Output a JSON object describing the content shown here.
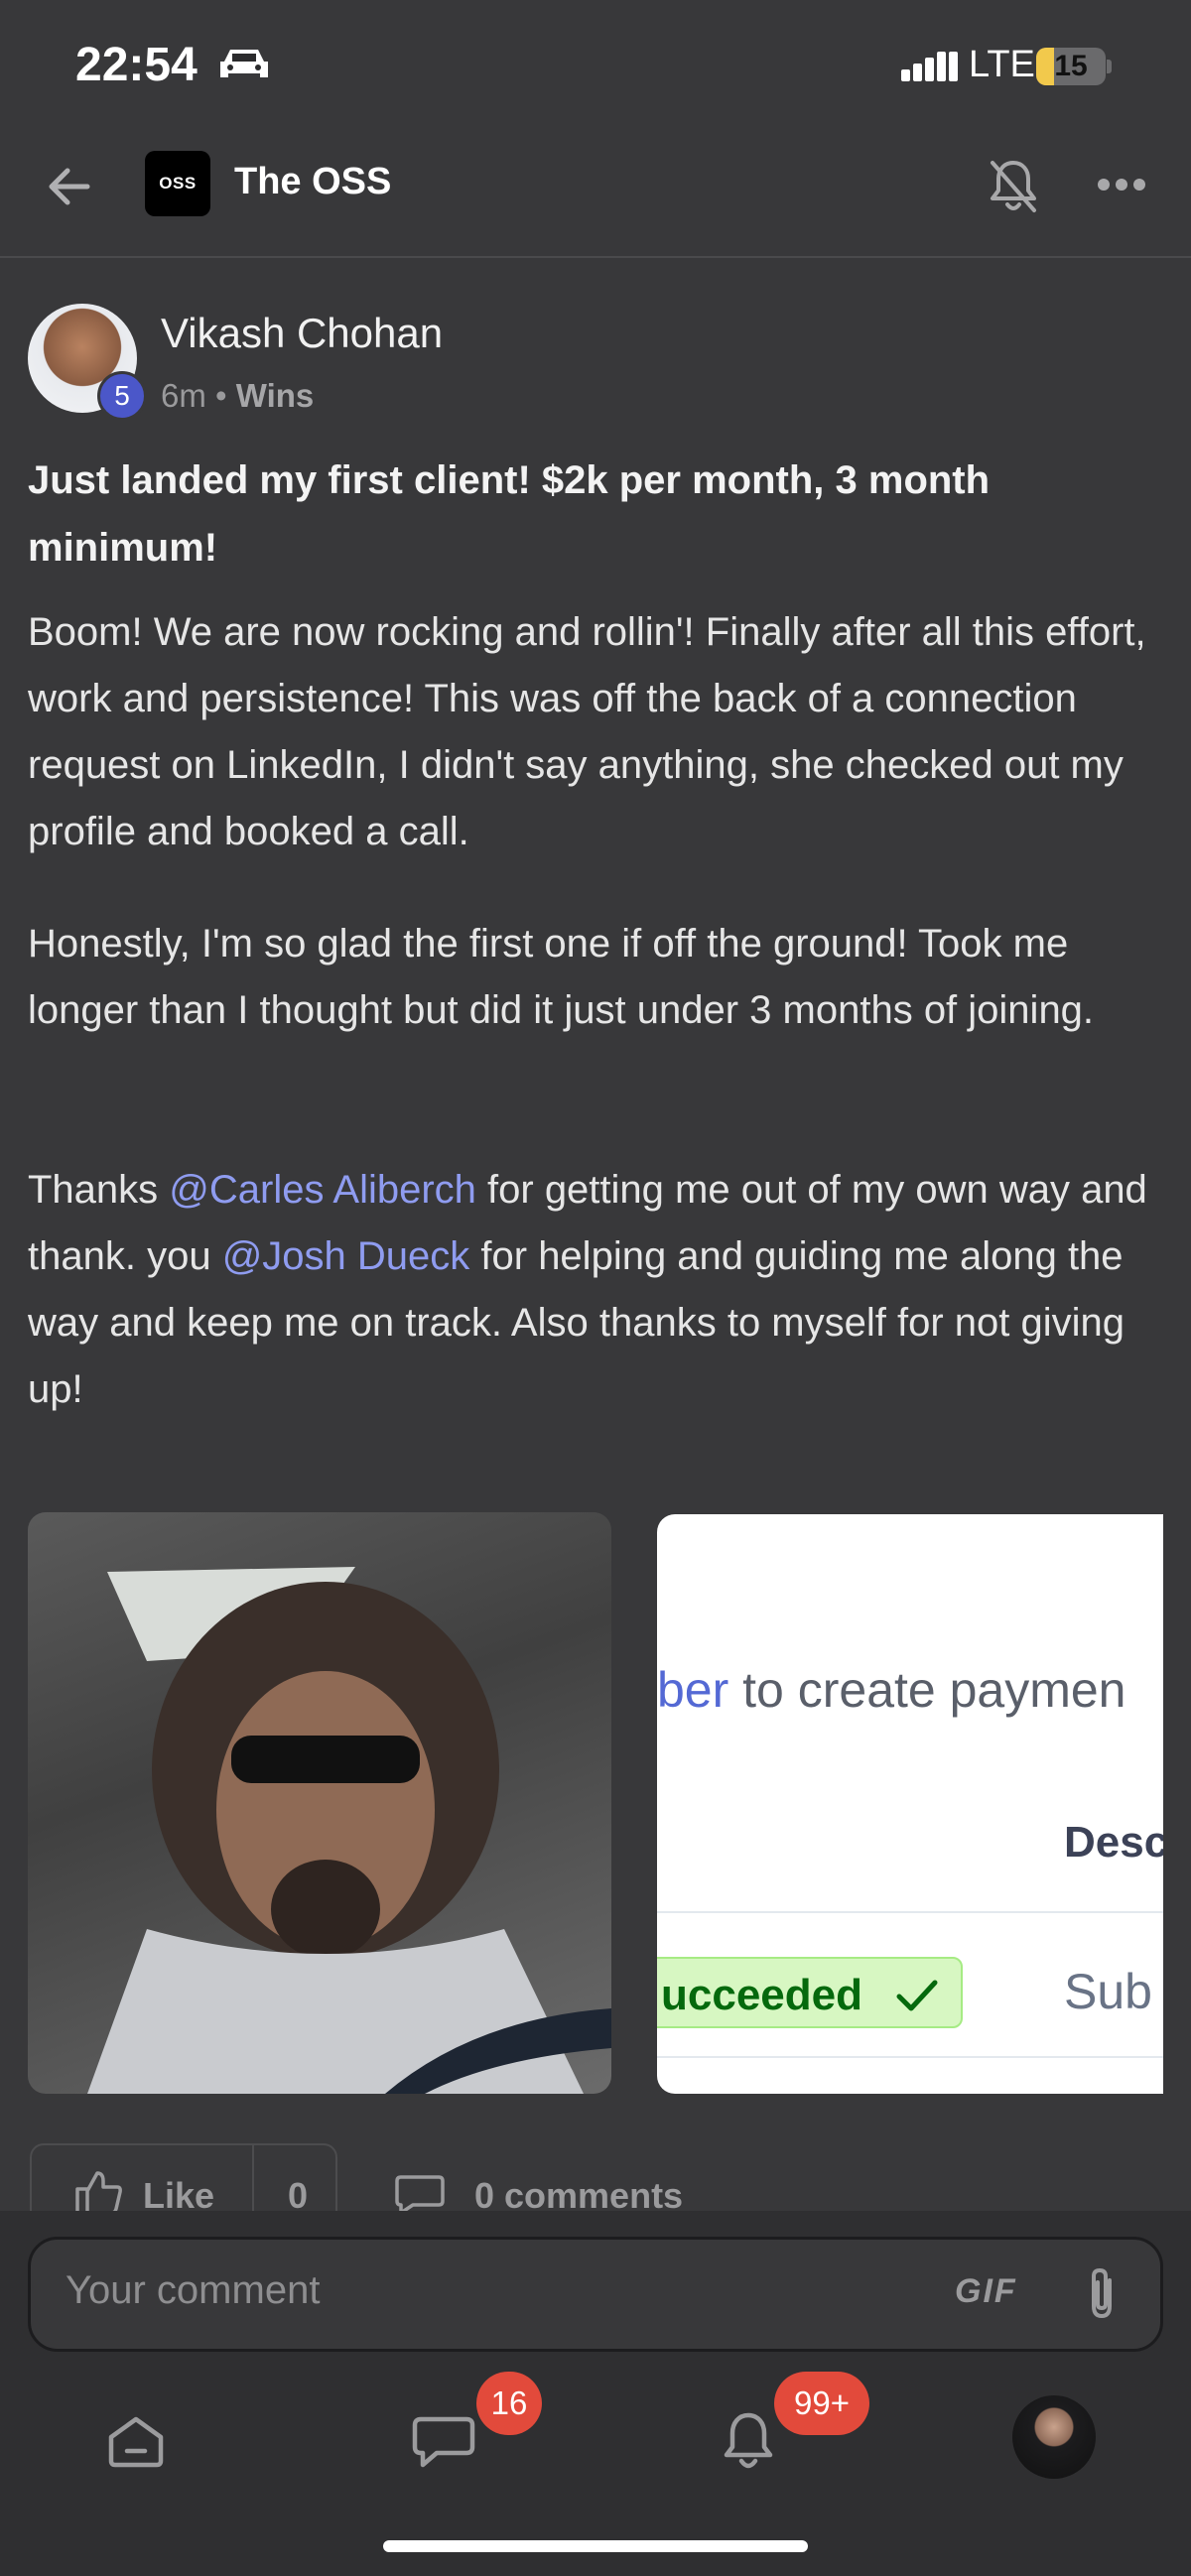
{
  "status_bar": {
    "time": "22:54",
    "network": "LTE",
    "battery": "15"
  },
  "header": {
    "group_logo": "OSS",
    "group_name": "The OSS"
  },
  "post": {
    "author": "Vikash Chohan",
    "level": "5",
    "time_ago": "6m",
    "separator": " • ",
    "category": "Wins",
    "title": "Just landed my first client! $2k per month, 3 month minimum!",
    "paragraph_1": "Boom! We are now rocking and rollin'! Finally after all this effort, work and persistence! This was off the back of a connection request on LinkedIn, I didn't say anything, she checked out my profile and booked a call.",
    "paragraph_2": "Honestly, I'm so glad the first one if off the ground! Took me longer than I thought but did it just under 3 months of joining.",
    "paragraph_3": {
      "part_1": "Thanks ",
      "mention_1": "@Carles Aliberch",
      "part_2": " for getting me out of my own way and thank. you ",
      "mention_2": "@Josh Dueck",
      "part_3": " for helping and guiding me along the way and keep me on track. Also thanks to myself for not giving up!"
    },
    "attachment_2": {
      "link_fragment": "ber",
      "text_fragment": " to create paymen",
      "column_fragment": "Desc",
      "status_fragment": "ucceeded",
      "cell_fragment": "Sub"
    },
    "like_label": "Like",
    "like_count": "0",
    "comments_label": "0 comments"
  },
  "composer": {
    "placeholder": "Your comment",
    "gif_label": "GIF"
  },
  "tab_bar": {
    "chat_badge": "16",
    "notifications_badge": "99+"
  },
  "icons": [
    "car-icon",
    "signal-icon",
    "battery-icon",
    "back-arrow-icon",
    "bell-off-icon",
    "more-icon",
    "thumbs-up-icon",
    "comment-icon",
    "paperclip-icon",
    "home-icon",
    "chat-icon",
    "bell-icon"
  ],
  "colors": {
    "background": "#38383a",
    "mention": "#8f9cf0",
    "badge": "#e24a3b",
    "level_badge": "#4b57c9"
  }
}
